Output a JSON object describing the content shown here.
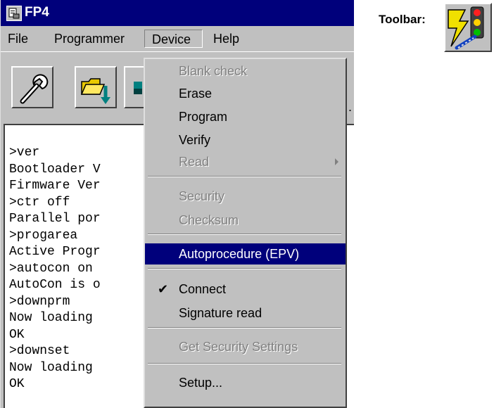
{
  "window": {
    "title": "FP4"
  },
  "menubar": {
    "file": "File",
    "programmer": "Programmer",
    "device": "Device",
    "help": "Help"
  },
  "device_menu": {
    "items": [
      {
        "label": "Blank check",
        "enabled": false
      },
      {
        "label": "Erase",
        "enabled": true
      },
      {
        "label": "Program",
        "enabled": true
      },
      {
        "label": "Verify",
        "enabled": true
      },
      {
        "label": "Read",
        "enabled": false,
        "submenu": true
      },
      {
        "label": "Security",
        "enabled": false
      },
      {
        "label": "Checksum",
        "enabled": false
      },
      {
        "label": "Autoprocedure (EPV)",
        "enabled": true,
        "highlighted": true
      },
      {
        "label": "Connect",
        "enabled": true,
        "checked": true
      },
      {
        "label": "Signature read",
        "enabled": true
      },
      {
        "label": "Get Security Settings",
        "enabled": false
      },
      {
        "label": "Setup...",
        "enabled": true
      }
    ]
  },
  "terminal": {
    "lines": [
      ">ver",
      "Bootloader V",
      "Firmware Ver",
      ">ctr off",
      "Parallel por",
      ">progarea",
      "Active Progr",
      ">autocon on",
      "AutoCon is o",
      ">downprm",
      "Now loading",
      "OK",
      ">downset",
      "Now loading",
      "OK"
    ],
    "trailing_mark": "."
  },
  "callout": {
    "label": "Toolbar:",
    "icon": "autoprocedure-traffic-light-icon"
  },
  "toolbar": {
    "icons": [
      "wrench-icon",
      "open-folder-icon",
      "toolbar-button-icon"
    ]
  },
  "colors": {
    "titlebar": "#00007b",
    "highlight": "#00007b",
    "face": "#c0c0c0"
  }
}
